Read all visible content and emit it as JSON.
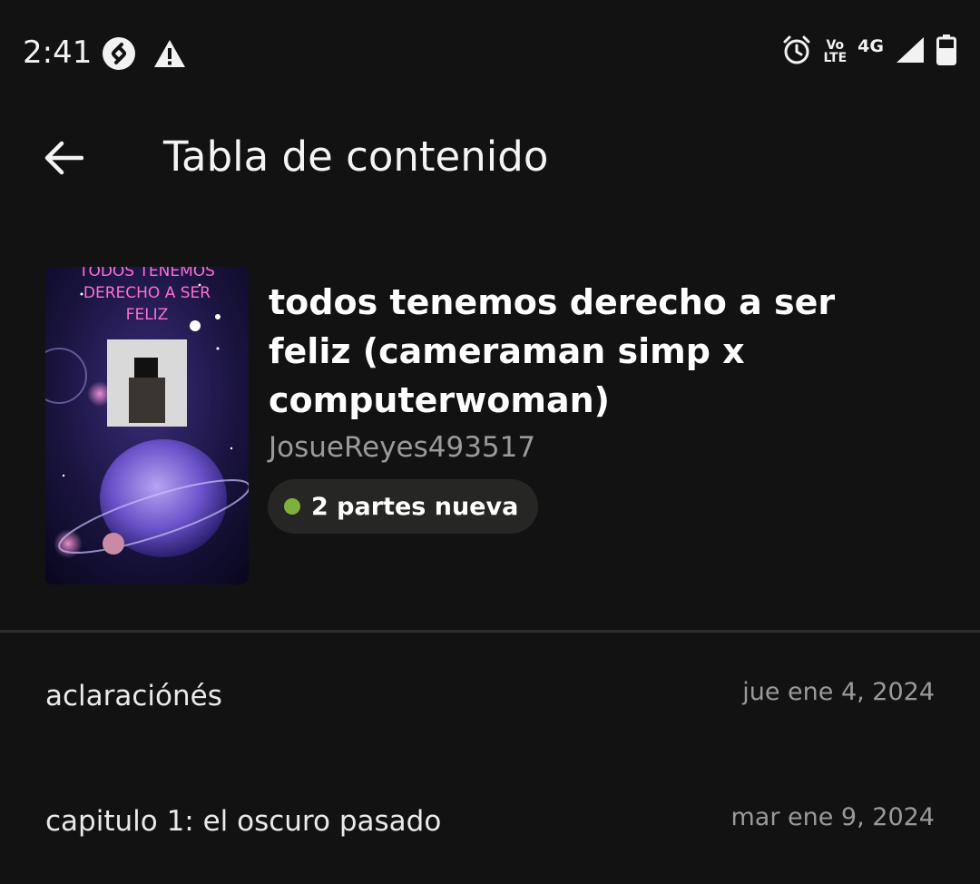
{
  "status_bar": {
    "time": "2:41",
    "left_icons": [
      "shazam-icon",
      "warning-icon"
    ],
    "right_icons": [
      "alarm-icon",
      "volte-icon",
      "network-4g-icon",
      "signal-icon",
      "battery-icon"
    ],
    "volte_top": "Vo",
    "volte_bottom": "LTE",
    "network": "4G"
  },
  "toolbar": {
    "back_icon": "arrow-left-icon",
    "title": "Tabla de contenido"
  },
  "story": {
    "cover_text": [
      "TODOS TENEMOS",
      "DERECHO A SER",
      "FELIZ"
    ],
    "title": "todos tenemos derecho a ser feliz (cameraman simp x computerwoman)",
    "author": "JosueReyes493517",
    "new_parts_label": "2 partes nueva",
    "new_dot_color": "#7fb03c"
  },
  "parts": [
    {
      "title": "aclaraciónés",
      "date": "jue ene 4, 2024"
    },
    {
      "title": "capitulo 1: el oscuro pasado",
      "date": "mar ene 9, 2024"
    }
  ]
}
